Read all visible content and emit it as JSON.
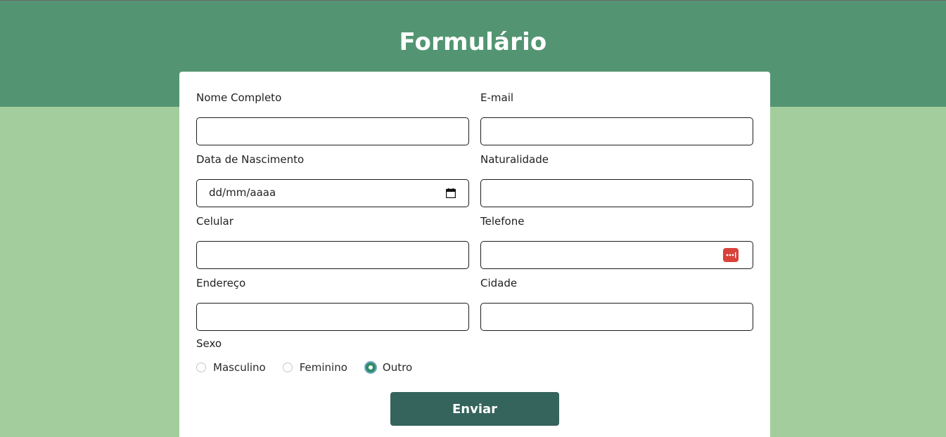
{
  "page": {
    "title": "Formulário",
    "colors": {
      "header": "#539572",
      "background": "#a3cd9d",
      "button": "#35645c",
      "radio_checked": "#2e8b67"
    }
  },
  "form": {
    "fields": [
      {
        "id": "nome",
        "label": "Nome Completo",
        "value": ""
      },
      {
        "id": "email",
        "label": "E-mail",
        "value": ""
      },
      {
        "id": "nascimento",
        "label": "Data de Nascimento",
        "value": "dd/mm/aaaa",
        "icon": "calendar-icon"
      },
      {
        "id": "naturalidade",
        "label": "Naturalidade",
        "value": ""
      },
      {
        "id": "celular",
        "label": "Celular",
        "value": ""
      },
      {
        "id": "telefone",
        "label": "Telefone",
        "value": "",
        "icon": "password-manager-icon"
      },
      {
        "id": "endereco",
        "label": "Endereço",
        "value": ""
      },
      {
        "id": "cidade",
        "label": "Cidade",
        "value": ""
      }
    ],
    "sexo": {
      "label": "Sexo",
      "options": [
        {
          "label": "Masculino",
          "checked": false
        },
        {
          "label": "Feminino",
          "checked": false
        },
        {
          "label": "Outro",
          "checked": true
        }
      ]
    },
    "submit_label": "Enviar"
  }
}
